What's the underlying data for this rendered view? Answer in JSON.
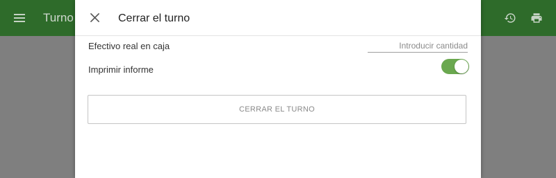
{
  "app_bar": {
    "title": "Turno",
    "menu_icon": "menu-icon",
    "history_icon": "history-icon",
    "print_icon": "printer-icon",
    "color": "#2e6b2a"
  },
  "dialog": {
    "title": "Cerrar el turno",
    "close_icon": "close-icon",
    "cash_label": "Efectivo real en caja",
    "cash_placeholder": "Introducir cantidad",
    "cash_value": "",
    "print_report_label": "Imprimir informe",
    "print_report_enabled": true,
    "toggle_color": "#6aa84f",
    "submit_label": "CERRAR EL TURNO"
  }
}
